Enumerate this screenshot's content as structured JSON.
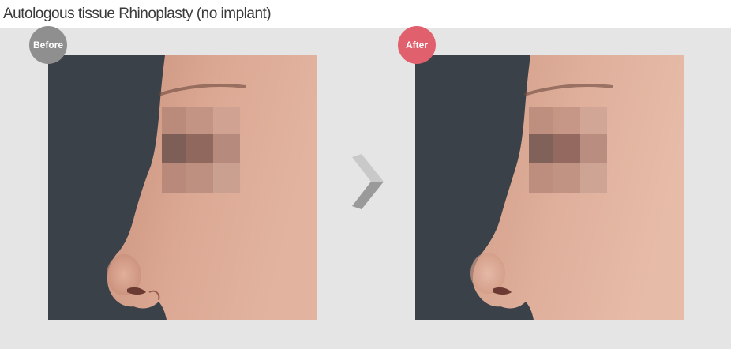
{
  "title": "Autologous tissue Rhinoplasty (no implant)",
  "colors": {
    "panel_bg": "#e5e5e5",
    "before_badge": "#8f8f8f",
    "after_badge": "#e0606e",
    "arrow": "#c9c9c9"
  },
  "comparison": {
    "before": {
      "badge_label": "Before"
    },
    "after": {
      "badge_label": "After"
    },
    "divider_icon": "chevron-right-icon"
  }
}
